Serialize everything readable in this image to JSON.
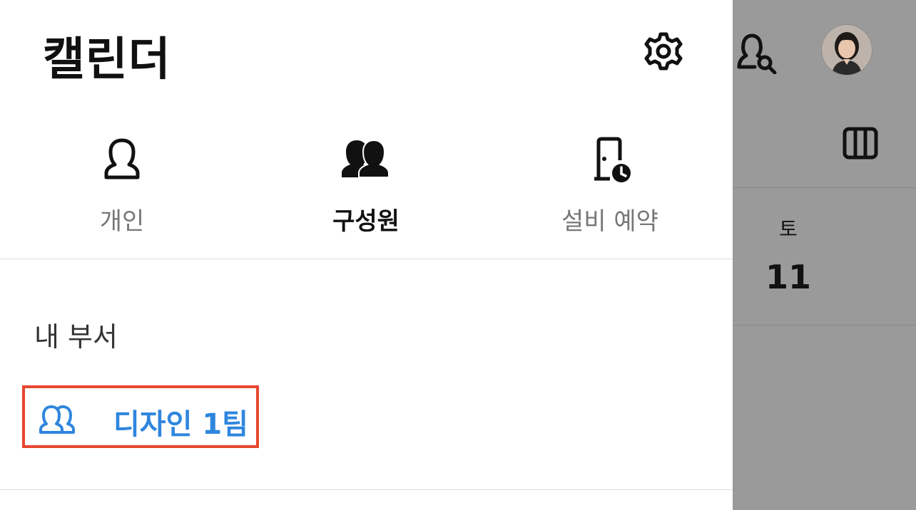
{
  "header": {
    "title": "캘린더"
  },
  "tabs": [
    {
      "label": "개인",
      "icon": "person-icon",
      "active": false
    },
    {
      "label": "구성원",
      "icon": "group-icon",
      "active": true
    },
    {
      "label": "설비 예약",
      "icon": "door-clock-icon",
      "active": false
    }
  ],
  "my_department": {
    "heading": "내 부서",
    "items": [
      {
        "label": "디자인 1팀",
        "icon": "group-outline-icon"
      }
    ]
  },
  "calendar_backdrop": {
    "day_label": "토",
    "day_number": "11"
  },
  "colors": {
    "accent_blue": "#2f86de",
    "highlight_red": "#e8462f",
    "backdrop_gray": "#9a9a9a"
  }
}
